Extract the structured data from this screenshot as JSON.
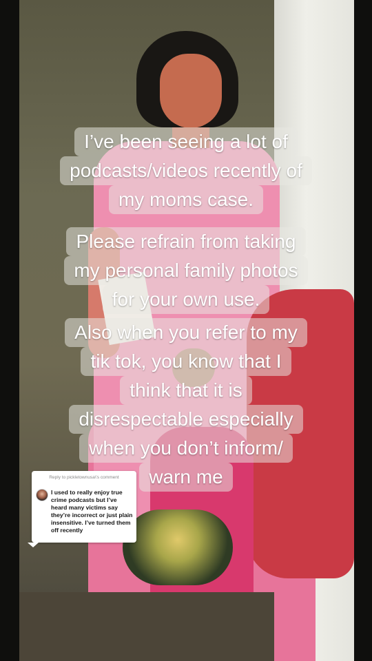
{
  "overlay": {
    "blocks": [
      {
        "lines": [
          "I’ve been seeing a lot of",
          "podcasts/videos recently of",
          "my moms case."
        ]
      },
      {
        "lines": [
          "Please refrain from taking",
          "my personal family photos",
          "for your own use."
        ]
      },
      {
        "lines": [
          "Also when you refer to my",
          "tik tok, you know that I",
          "think that it is",
          "disrespectable especially",
          "when you don’t inform/",
          "warn me"
        ]
      }
    ]
  },
  "reply_sticker": {
    "header": "Reply to pickletownusa\\'s comment",
    "comment": "I used to really enjoy true crime podcasts but I’ve heard many victims say they’re incorrect or just plain insensitive. I’ve turned them off recently",
    "avatar_icon": "user-avatar"
  },
  "colors": {
    "caption_bg": "#e8e8e2",
    "caption_text": "#ffffff"
  }
}
